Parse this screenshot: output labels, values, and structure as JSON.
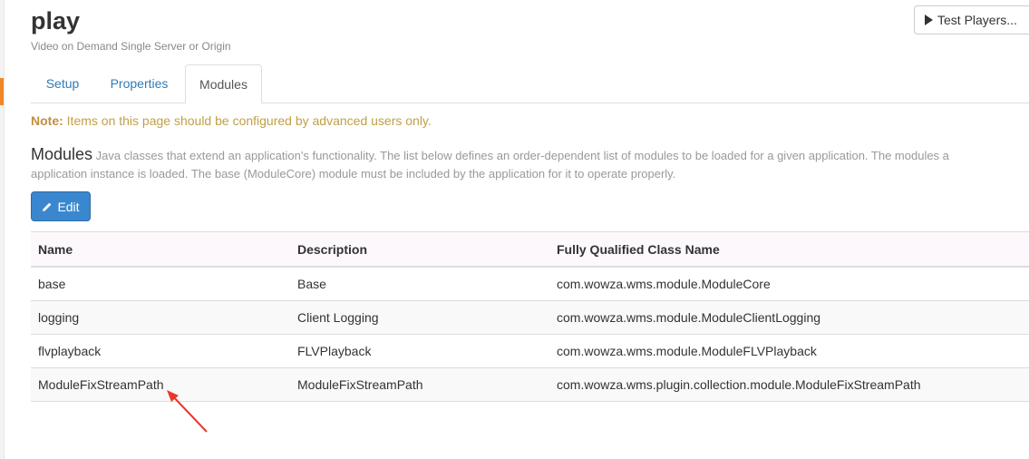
{
  "header": {
    "title": "play",
    "subtitle": "Video on Demand Single Server or Origin",
    "test_players_label": "Test Players..."
  },
  "tabs": [
    {
      "label": "Setup",
      "active": false
    },
    {
      "label": "Properties",
      "active": false
    },
    {
      "label": "Modules",
      "active": true
    }
  ],
  "note": {
    "prefix": "Note:",
    "text": " Items on this page should be configured by advanced users only."
  },
  "modules_section": {
    "heading": "Modules",
    "description_line1": "Java classes that extend an application's functionality. The list below defines an order-dependent list of modules to be loaded for a given application. The modules a",
    "description_line2": "application instance is loaded. The base (ModuleCore) module must be included by the application for it to operate properly.",
    "edit_label": "Edit"
  },
  "table": {
    "headers": [
      "Name",
      "Description",
      "Fully Qualified Class Name"
    ],
    "rows": [
      [
        "base",
        "Base",
        "com.wowza.wms.module.ModuleCore"
      ],
      [
        "logging",
        "Client Logging",
        "com.wowza.wms.module.ModuleClientLogging"
      ],
      [
        "flvplayback",
        "FLVPlayback",
        "com.wowza.wms.module.ModuleFLVPlayback"
      ],
      [
        "ModuleFixStreamPath",
        "ModuleFixStreamPath",
        "com.wowza.wms.plugin.collection.module.ModuleFixStreamPath"
      ]
    ]
  },
  "colors": {
    "accent_orange": "#f0882a",
    "link_blue": "#337ab7",
    "edit_button": "#3a87cf",
    "note_text": "#c0a045",
    "annotation_arrow": "#e8392d"
  }
}
